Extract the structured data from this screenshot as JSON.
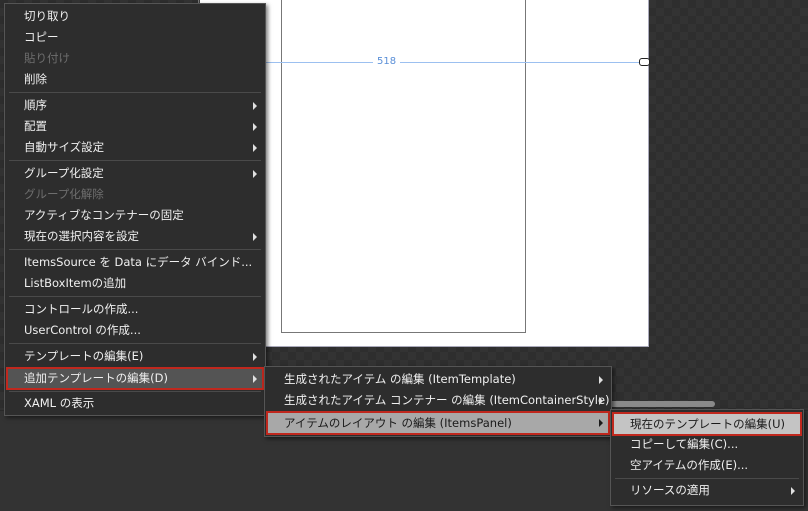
{
  "artboard": {
    "measure_label": "518"
  },
  "context_menu": {
    "items": [
      {
        "label": "切り取り"
      },
      {
        "label": "コピー"
      },
      {
        "label": "貼り付け"
      },
      {
        "label": "削除"
      },
      {
        "label": "順序"
      },
      {
        "label": "配置"
      },
      {
        "label": "自動サイズ設定"
      },
      {
        "label": "グループ化設定"
      },
      {
        "label": "グループ化解除"
      },
      {
        "label": "アクティブなコンテナーの固定"
      },
      {
        "label": "現在の選択内容を設定"
      },
      {
        "label": "ItemsSource を Data にデータ バインド..."
      },
      {
        "label": "ListBoxItemの追加"
      },
      {
        "label": "コントロールの作成..."
      },
      {
        "label": "UserControl の作成..."
      },
      {
        "label": "テンプレートの編集(E)"
      },
      {
        "label": "追加テンプレートの編集(D)"
      },
      {
        "label": "XAML の表示"
      }
    ]
  },
  "submenu_templates": {
    "items": [
      {
        "label": "生成されたアイテム の編集 (ItemTemplate)"
      },
      {
        "label": "生成されたアイテム コンテナー の編集 (ItemContainerStyle)"
      },
      {
        "label": "アイテムのレイアウト の編集 (ItemsPanel)"
      }
    ]
  },
  "submenu_itemspanel": {
    "items": [
      {
        "label": "現在のテンプレートの編集(U)"
      },
      {
        "label": "コピーして編集(C)..."
      },
      {
        "label": "空アイテムの作成(E)..."
      },
      {
        "label": "リソースの適用"
      }
    ]
  },
  "colors": {
    "highlight_border": "#c0281e",
    "menu_bg": "#2d2d2d"
  }
}
